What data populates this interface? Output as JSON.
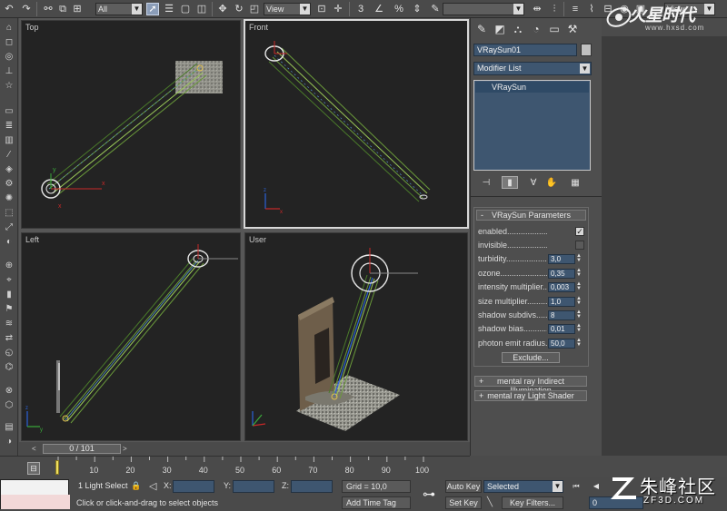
{
  "toolbar": {
    "selection_filter": "All",
    "ref_coord_1": "View",
    "named_selection": "",
    "ref_coord_2": "View"
  },
  "logo": {
    "brand_text": "火星时代",
    "url": "www.hxsd.com"
  },
  "viewports": [
    {
      "label": "Top"
    },
    {
      "label": "Front"
    },
    {
      "label": "Left"
    },
    {
      "label": "User"
    }
  ],
  "command_panel": {
    "object_name": "VRaySun01",
    "modifier_list": "Modifier List",
    "stack_item": "VRaySun",
    "rollout_title": "VRaySun Parameters",
    "rollout_sign": "-",
    "params": [
      {
        "label": "enabled..............................",
        "type": "check",
        "checked": "✓"
      },
      {
        "label": "invisible.............................",
        "type": "check",
        "checked": ""
      },
      {
        "label": "turbidity...........................",
        "type": "value",
        "value": "3,0"
      },
      {
        "label": "ozone.................................",
        "type": "value",
        "value": "0,35"
      },
      {
        "label": "intensity multiplier...",
        "type": "value",
        "value": "0,003"
      },
      {
        "label": "size multiplier............",
        "type": "value",
        "value": "1,0"
      },
      {
        "label": "shadow subdivs.........",
        "type": "value",
        "value": "8"
      },
      {
        "label": "shadow bias...............",
        "type": "value",
        "value": "0,01"
      },
      {
        "label": "photon emit radius..",
        "type": "value",
        "value": "50,0"
      }
    ],
    "exclude_label": "Exclude...",
    "rollout_mr_gi": "mental ray Indirect Illumination",
    "rollout_mr_shader": "mental ray Light Shader",
    "rollout_mr_sign": "+"
  },
  "time_slider": {
    "frame_label": "0 / 101",
    "prev_arrow": "<",
    "next_arrow": ">"
  },
  "track": {
    "ticks": [
      "10",
      "20",
      "30",
      "40",
      "50",
      "60",
      "70",
      "80",
      "90",
      "100"
    ]
  },
  "status": {
    "selection_count": "1 Light Select",
    "prompt": "Click or click-and-drag to select objects",
    "x_label": "X:",
    "y_label": "Y:",
    "z_label": "Z:",
    "grid": "Grid = 10,0",
    "add_time_tag": "Add Time Tag",
    "auto_key": "Auto Key",
    "set_key": "Set Key",
    "key_mode": "Selected",
    "key_filters": "Key Filters...",
    "current_frame": "0"
  },
  "watermark": {
    "cn": "朱峰社区",
    "en": "ZF3D.COM"
  }
}
